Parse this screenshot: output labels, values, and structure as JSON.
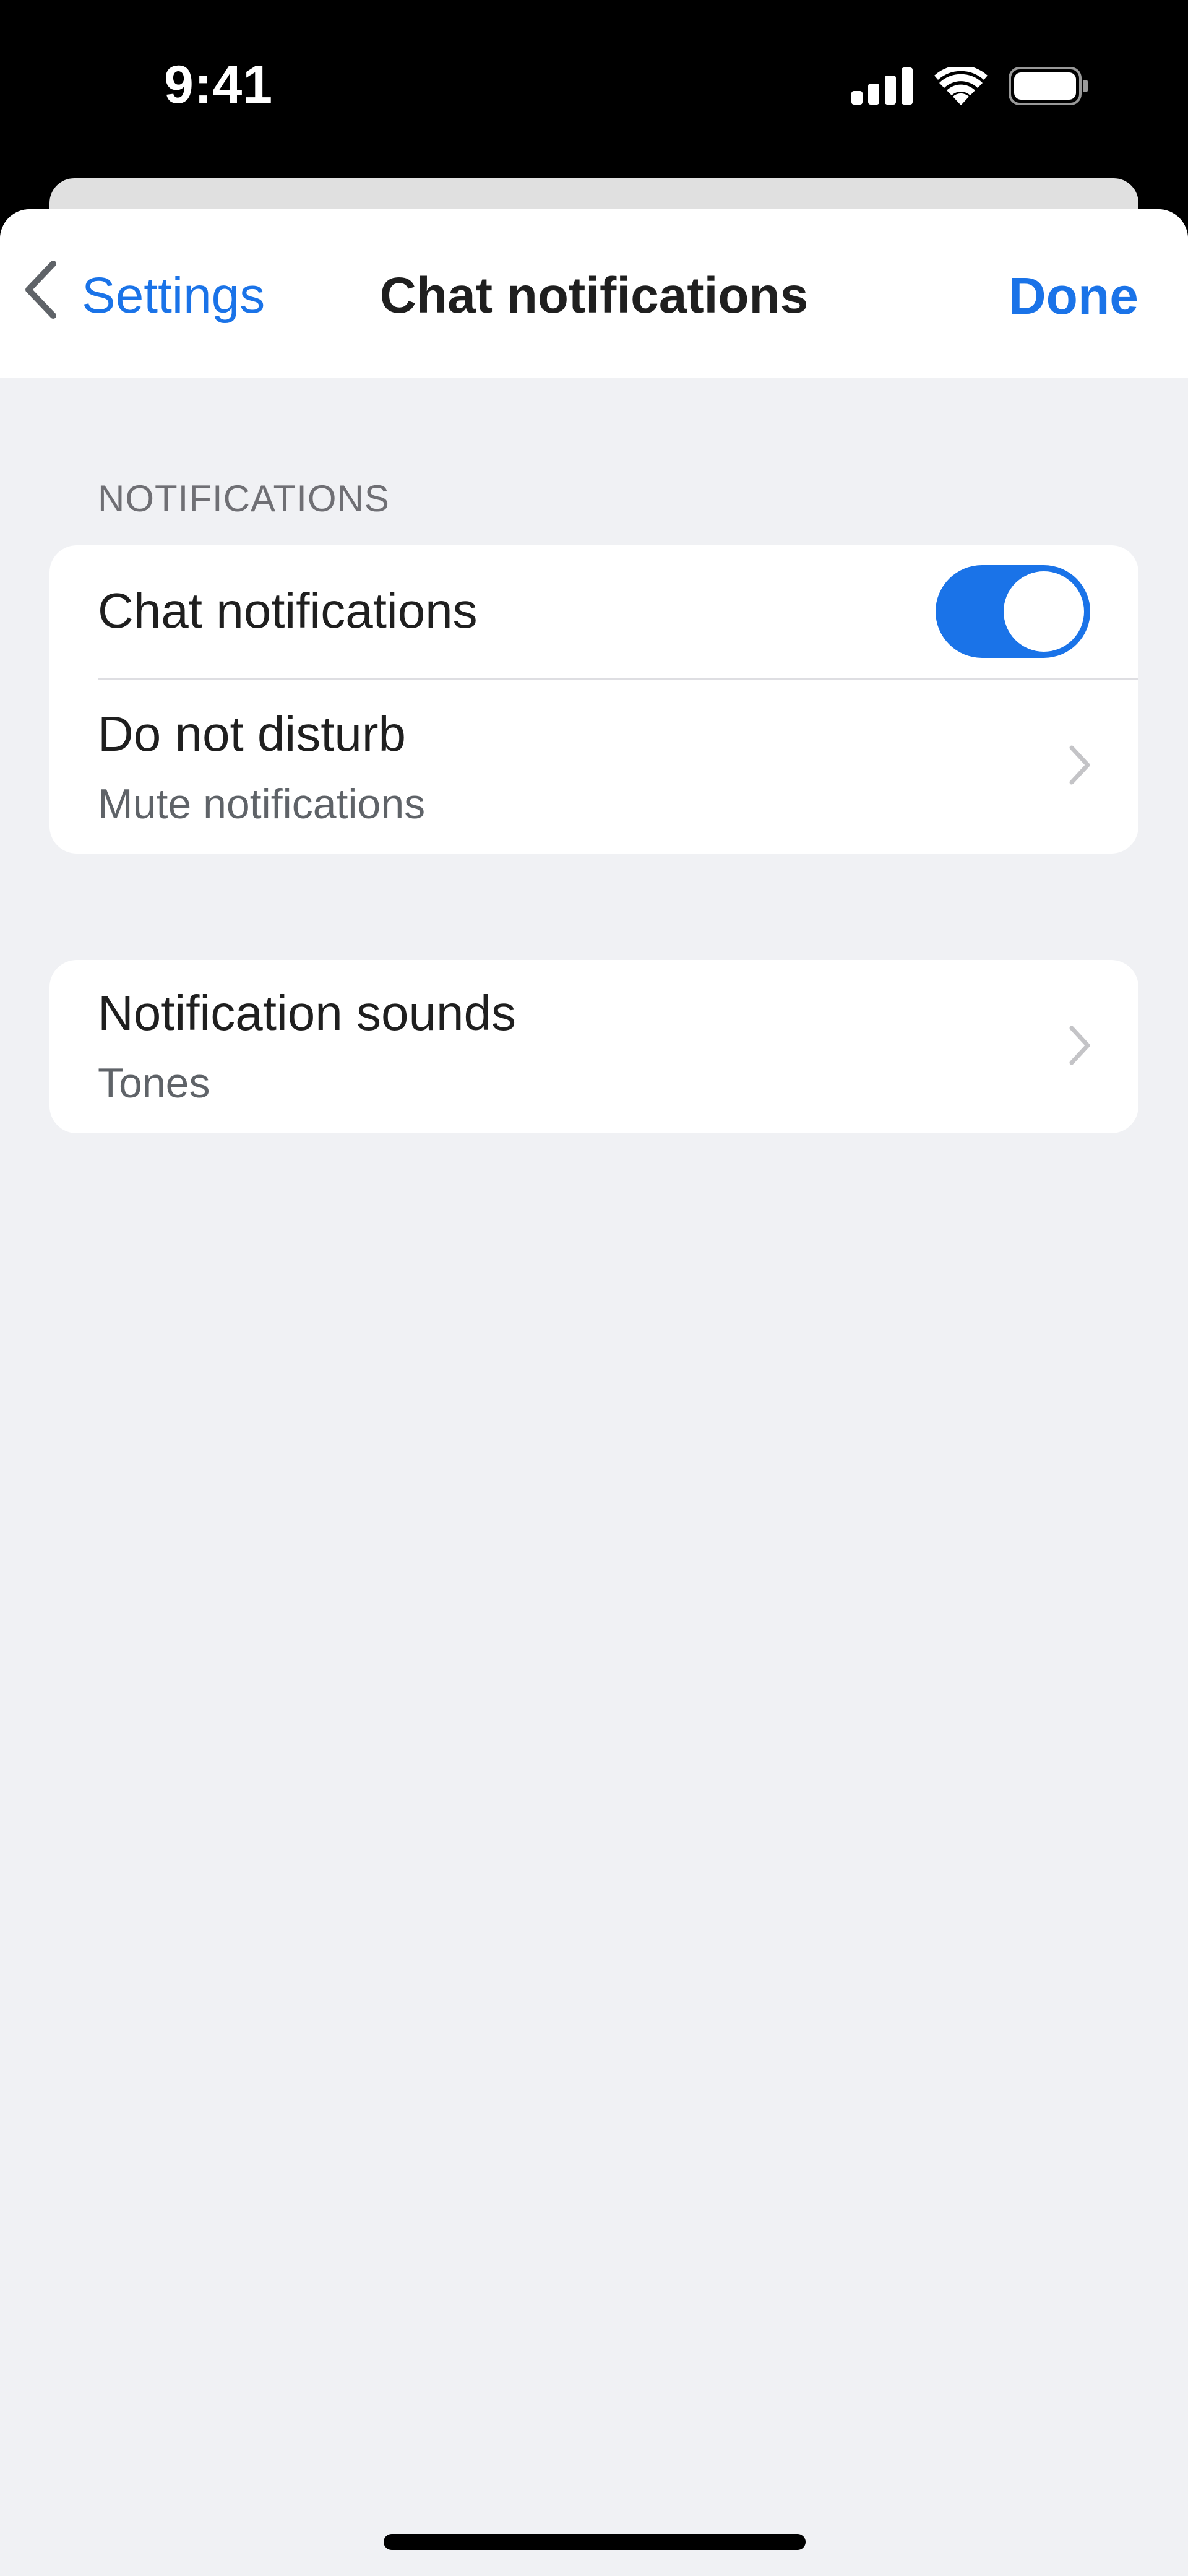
{
  "status_bar": {
    "time": "9:41"
  },
  "nav": {
    "back_label": "Settings",
    "title": "Chat notifications",
    "done_label": "Done"
  },
  "sections": {
    "notifications_header": "NOTIFICATIONS"
  },
  "rows": {
    "chat_notifications": {
      "label": "Chat notifications",
      "toggle_on": true
    },
    "do_not_disturb": {
      "label": "Do not disturb",
      "sublabel": "Mute notifications"
    },
    "notification_sounds": {
      "label": "Notification sounds",
      "sublabel": "Tones"
    }
  },
  "colors": {
    "accent": "#1a73e8",
    "background": "#f0f1f4",
    "card": "#ffffff"
  }
}
